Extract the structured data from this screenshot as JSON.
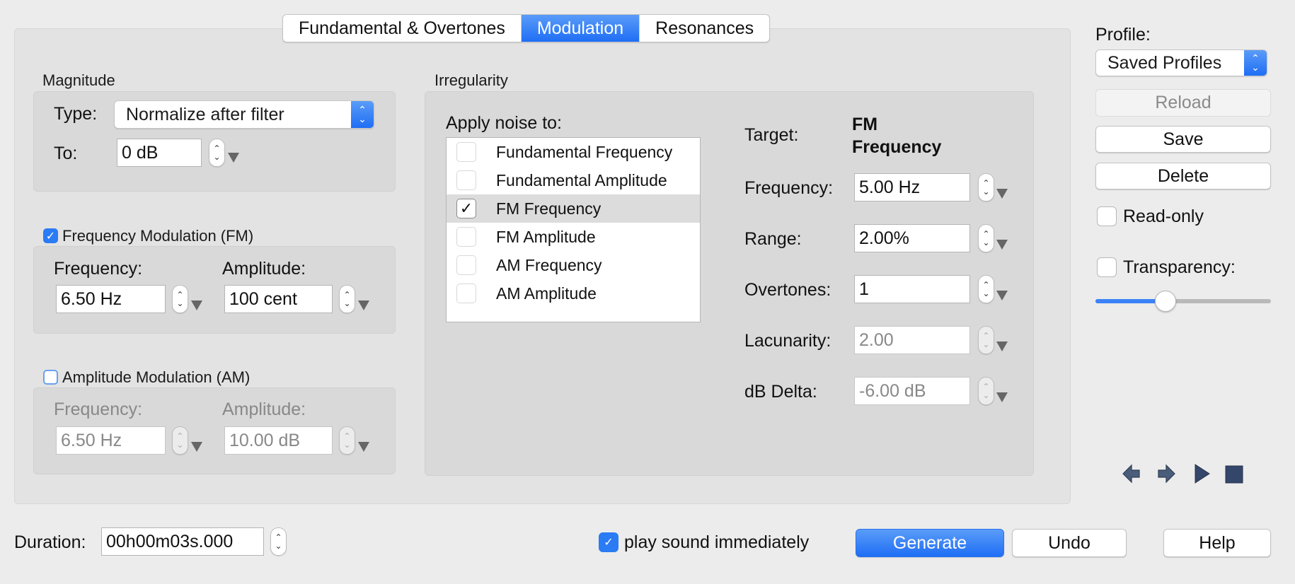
{
  "tabs": [
    {
      "label": "Fundamental & Overtones",
      "active": false
    },
    {
      "label": "Modulation",
      "active": true
    },
    {
      "label": "Resonances",
      "active": false
    }
  ],
  "magnitude": {
    "group_label": "Magnitude",
    "type_label": "Type:",
    "type_value": "Normalize after filter",
    "to_label": "To:",
    "to_value": "0 dB"
  },
  "fm": {
    "checkbox_label": "Frequency Modulation (FM)",
    "checked": true,
    "frequency_label": "Frequency:",
    "frequency_value": "6.50 Hz",
    "amplitude_label": "Amplitude:",
    "amplitude_value": "100 cent"
  },
  "am": {
    "checkbox_label": "Amplitude Modulation (AM)",
    "checked": false,
    "frequency_label": "Frequency:",
    "frequency_value": "6.50 Hz",
    "amplitude_label": "Amplitude:",
    "amplitude_value": "10.00 dB"
  },
  "irregularity": {
    "group_label": "Irregularity",
    "apply_label": "Apply noise to:",
    "targets": [
      {
        "label": "Fundamental Frequency",
        "checked": false,
        "selected": false
      },
      {
        "label": "Fundamental Amplitude",
        "checked": false,
        "selected": false
      },
      {
        "label": "FM Frequency",
        "checked": true,
        "selected": true
      },
      {
        "label": "FM Amplitude",
        "checked": false,
        "selected": false
      },
      {
        "label": "AM Frequency",
        "checked": false,
        "selected": false
      },
      {
        "label": "AM Amplitude",
        "checked": false,
        "selected": false
      }
    ],
    "target_label": "Target:",
    "target_line1": "FM",
    "target_line2": "Frequency",
    "params": [
      {
        "label": "Frequency:",
        "value": "5.00 Hz",
        "enabled": true
      },
      {
        "label": "Range:",
        "value": "2.00%",
        "enabled": true
      },
      {
        "label": "Overtones:",
        "value": "1",
        "enabled": true
      },
      {
        "label": "Lacunarity:",
        "value": "2.00",
        "enabled": false
      },
      {
        "label": "dB Delta:",
        "value": "-6.00 dB",
        "enabled": false
      }
    ]
  },
  "profile": {
    "label": "Profile:",
    "select_value": "Saved Profiles",
    "reload_label": "Reload",
    "save_label": "Save",
    "delete_label": "Delete",
    "readonly_label": "Read-only",
    "readonly_checked": false,
    "transparency_label": "Transparency:",
    "transparency_checked": false,
    "transparency_value": 0.4
  },
  "nav_icons": [
    "arrow-left-icon",
    "arrow-right-icon",
    "play-icon",
    "stop-icon"
  ],
  "footer": {
    "duration_label": "Duration:",
    "duration_value": "00h00m03s.000",
    "play_label": "play sound immediately",
    "play_checked": true,
    "generate_label": "Generate",
    "undo_label": "Undo",
    "help_label": "Help"
  },
  "colors": {
    "accent": "#1f6ef5",
    "panel": "#e3e3e3",
    "group_box": "#d9d9d9",
    "window": "#ececec"
  }
}
